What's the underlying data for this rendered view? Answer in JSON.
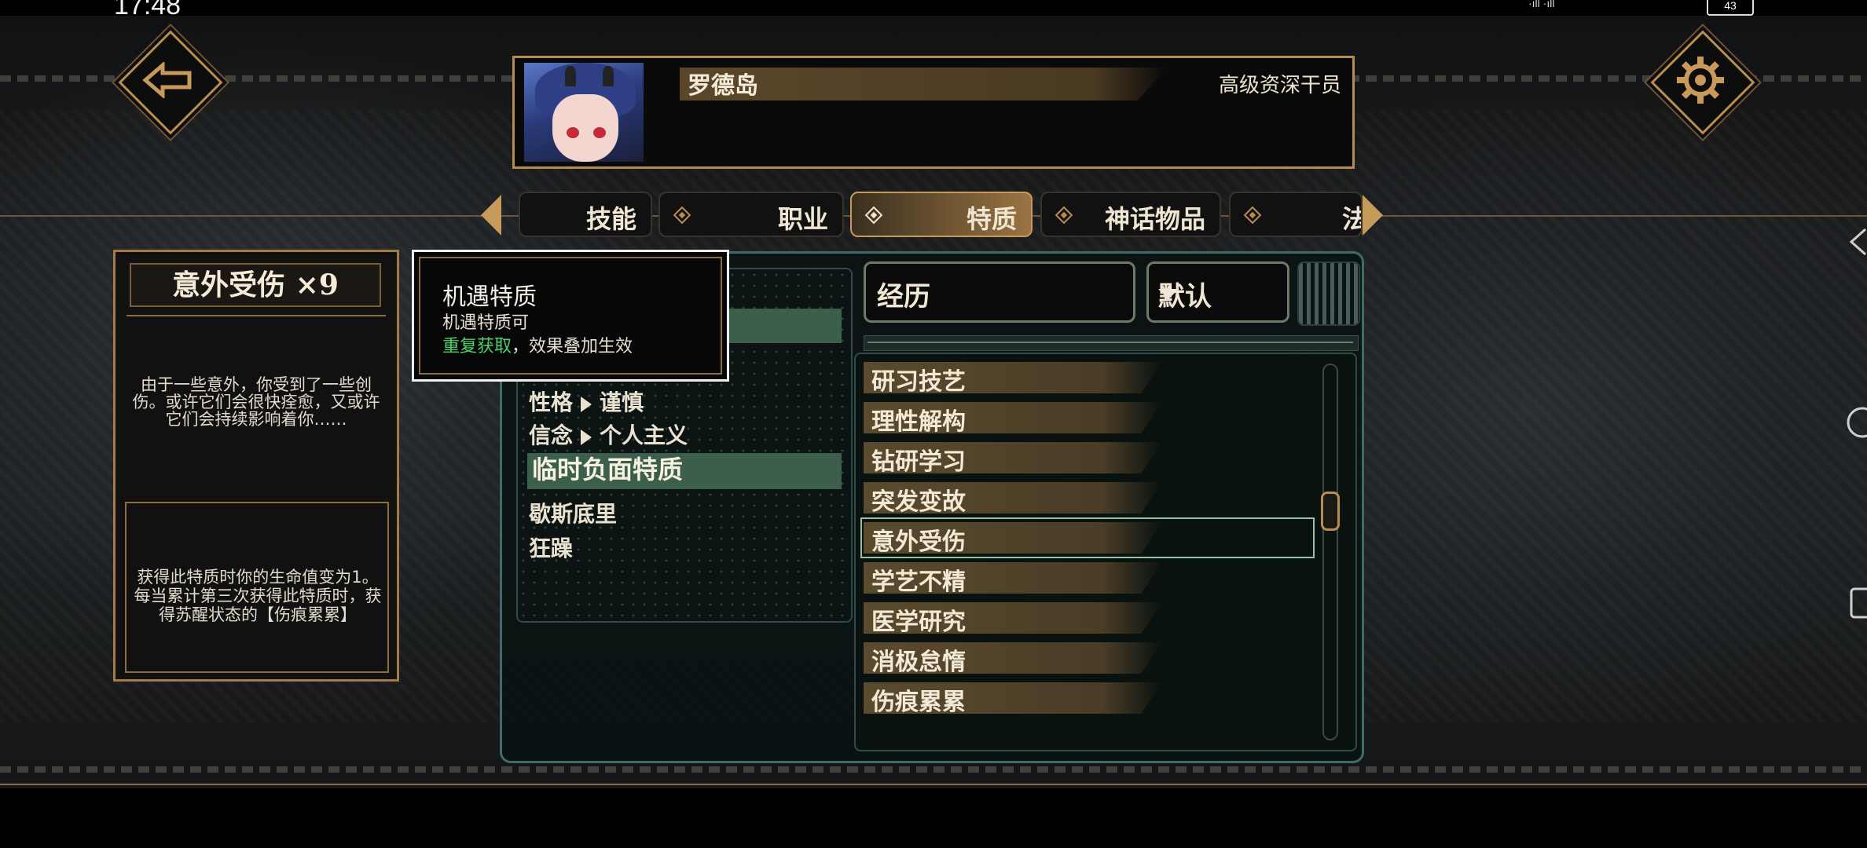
{
  "status_bar": {
    "time": "17:48",
    "right_text": "·ıll ·ıll",
    "battery": "43"
  },
  "profile": {
    "name": "罗德岛",
    "rank": "高级资深干员"
  },
  "tabs": [
    {
      "label": "技能",
      "active": false
    },
    {
      "label": "职业",
      "active": false
    },
    {
      "label": "特质",
      "active": true
    },
    {
      "label": "神话物品",
      "active": false
    },
    {
      "label": "法",
      "active": false
    }
  ],
  "detail_card": {
    "title": "意外受伤 ×9",
    "description": "由于一些意外，你受到了一些创伤。或许它们会很快痊愈，又或许它们会持续影响着你……",
    "effect": "获得此特质时你的生命值变为1。每当累计第三次获得此特质时，获得苏醒状态的【伤痕累累】"
  },
  "tooltip": {
    "title": "机遇特质",
    "subtitle": "机遇特质可",
    "highlight": "重复获取",
    "rest": "，效果叠加生效"
  },
  "left_list": {
    "items": [
      {
        "label": "性格",
        "value": "谨慎"
      },
      {
        "label": "信念",
        "value": "个人主义"
      }
    ],
    "section_header": "临时负面特质",
    "section_items": [
      "歇斯底里",
      "狂躁"
    ]
  },
  "filters": {
    "category_value": "经历",
    "sort_value": "默认"
  },
  "right_list": {
    "items": [
      "研习技艺",
      "理性解构",
      "钻研学习",
      "突发变故",
      "意外受伤",
      "学艺不精",
      "医学研究",
      "消极怠惰",
      "伤痕累累"
    ],
    "selected": "意外受伤"
  },
  "icons": {
    "back": "back-arrow-icon",
    "settings": "gear-icon"
  },
  "colors": {
    "gold": "#b98d52",
    "teal_border": "#3f6b69",
    "highlight_green": "#3c5f4c",
    "tooltip_green": "#4fd06a"
  }
}
